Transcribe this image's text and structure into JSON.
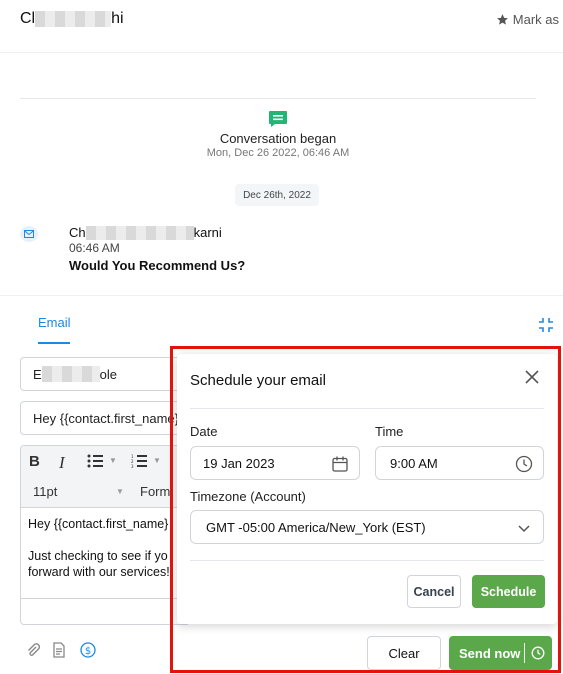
{
  "header": {
    "contact_name_start": "Cl",
    "contact_name_end": "hi",
    "mark_as_label": "Mark as"
  },
  "conversation": {
    "title": "Conversation began",
    "started": "Mon, Dec 26 2022, 06:46 AM",
    "date_separator": "Dec 26th, 2022"
  },
  "message": {
    "sender_start": "Ch",
    "sender_end": "karni",
    "time": "06:46 AM",
    "subject": "Would You Recommend Us?"
  },
  "composer": {
    "tab_label": "Email",
    "from_start": "E",
    "from_end": "ole",
    "subject_value": "Hey {{contact.first_name}",
    "font_size": "11pt",
    "format_label": "Form",
    "body_line1": "Hey {{contact.first_name}",
    "body_line2": "Just checking to see if yo",
    "body_line3": "forward with our services!",
    "clear_label": "Clear",
    "send_label": "Send now"
  },
  "schedule_modal": {
    "title": "Schedule your email",
    "date_label": "Date",
    "date_value": "19 Jan 2023",
    "time_label": "Time",
    "time_value": "9:00 AM",
    "timezone_label": "Timezone (Account)",
    "timezone_value": "GMT -05:00 America/New_York (EST)",
    "cancel_label": "Cancel",
    "schedule_label": "Schedule"
  },
  "colors": {
    "accent_blue": "#1e88e5",
    "send_green": "#5ba84a",
    "highlight_red": "#e3120b"
  },
  "icons": [
    "star-icon",
    "chat-icon",
    "mail-icon",
    "collapse-icon",
    "bold-icon",
    "italic-icon",
    "bullet-list-icon",
    "numbered-list-icon",
    "attachment-icon",
    "document-icon",
    "dollar-icon",
    "close-icon",
    "calendar-icon",
    "clock-icon",
    "chevron-down-icon"
  ]
}
